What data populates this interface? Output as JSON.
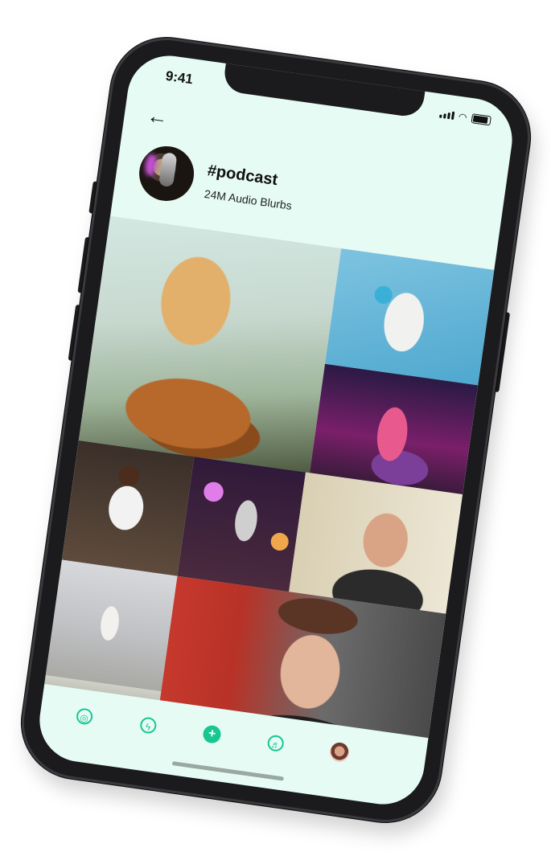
{
  "status": {
    "time": "9:41"
  },
  "header": {
    "back_icon": "←",
    "title": "#podcast",
    "subtitle": "24M Audio Blurbs"
  },
  "grid": {
    "tiles": [
      {
        "kind": "image",
        "description_name": "singer-guitar-tile"
      },
      {
        "kind": "image",
        "description_name": "selfie-headphones-tile"
      },
      {
        "kind": "image",
        "description_name": "stage-singer-tile"
      },
      {
        "kind": "image",
        "description_name": "studio-headphones-tile"
      },
      {
        "kind": "image",
        "description_name": "microphone-tile"
      },
      {
        "kind": "image",
        "description_name": "glasses-headphones-tile"
      },
      {
        "kind": "image",
        "description_name": "violin-tile"
      },
      {
        "kind": "image",
        "description_name": "duo-tile"
      },
      {
        "kind": "image",
        "description_name": "man-headphones-tile"
      }
    ]
  },
  "nav": {
    "items": [
      {
        "name": "discover",
        "icon": "compass-icon",
        "glyph": "◎"
      },
      {
        "name": "activity",
        "icon": "lightning-icon",
        "glyph": "ϟ"
      },
      {
        "name": "create",
        "icon": "plus-icon",
        "glyph": "+"
      },
      {
        "name": "record",
        "icon": "microphone-icon",
        "glyph": "♬"
      },
      {
        "name": "profile",
        "icon": "avatar-icon",
        "glyph": ""
      }
    ]
  },
  "colors": {
    "accent": "#18c692",
    "screen_bg": "#e6fbf4"
  }
}
